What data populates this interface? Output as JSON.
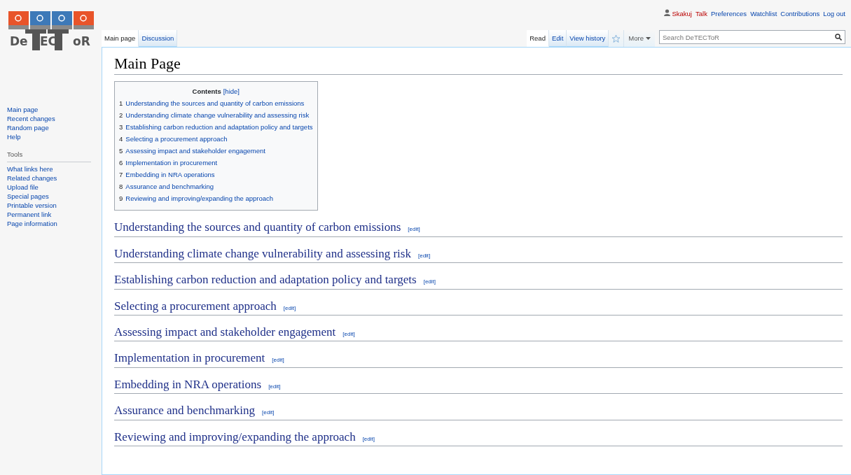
{
  "personal": [
    {
      "label": "Skakuj",
      "redlink": true,
      "kind": "user"
    },
    {
      "label": "Talk",
      "redlink": true,
      "kind": "link"
    },
    {
      "label": "Preferences",
      "redlink": false,
      "kind": "link"
    },
    {
      "label": "Watchlist",
      "redlink": false,
      "kind": "link"
    },
    {
      "label": "Contributions",
      "redlink": false,
      "kind": "link"
    },
    {
      "label": "Log out",
      "redlink": false,
      "kind": "link"
    }
  ],
  "logo": {
    "parts": [
      "De",
      "EC",
      "oR"
    ]
  },
  "left_tabs": [
    {
      "label": "Main page",
      "selected": true
    },
    {
      "label": "Discussion",
      "selected": false
    }
  ],
  "right_tabs": [
    {
      "label": "Read",
      "selected": true,
      "kind": "tab"
    },
    {
      "label": "Edit",
      "selected": false,
      "kind": "tab"
    },
    {
      "label": "View history",
      "selected": false,
      "kind": "tab"
    },
    {
      "kind": "watch"
    },
    {
      "label": "More",
      "kind": "menu"
    }
  ],
  "search": {
    "placeholder": "Search DeTECToR"
  },
  "sidebar": {
    "items": [
      "Main page",
      "Recent changes",
      "Random page",
      "Help"
    ],
    "tools_heading": "Tools",
    "tools": [
      "What links here",
      "Related changes",
      "Upload file",
      "Special pages",
      "Printable version",
      "Permanent link",
      "Page information"
    ]
  },
  "title": "Main Page",
  "toc": {
    "title": "Contents",
    "toggle": "[hide]",
    "entries": [
      {
        "number": "1",
        "text": "Understanding the sources and quantity of carbon emissions"
      },
      {
        "number": "2",
        "text": "Understanding climate change vulnerability and assessing risk"
      },
      {
        "number": "3",
        "text": "Establishing carbon reduction and adaptation policy and targets"
      },
      {
        "number": "4",
        "text": "Selecting a procurement approach"
      },
      {
        "number": "5",
        "text": "Assessing impact and stakeholder engagement"
      },
      {
        "number": "6",
        "text": "Implementation in procurement"
      },
      {
        "number": "7",
        "text": "Embedding in NRA operations"
      },
      {
        "number": "8",
        "text": "Assurance and benchmarking"
      },
      {
        "number": "9",
        "text": "Reviewing and improving/expanding the approach"
      }
    ]
  },
  "sections": [
    {
      "heading": "Understanding the sources and quantity of carbon emissions",
      "edit": "[edit]"
    },
    {
      "heading": "Understanding climate change vulnerability and assessing risk",
      "edit": "[edit]"
    },
    {
      "heading": "Establishing carbon reduction and adaptation policy and targets",
      "edit": "[edit]"
    },
    {
      "heading": "Selecting a procurement approach",
      "edit": "[edit]"
    },
    {
      "heading": "Assessing impact and stakeholder engagement",
      "edit": "[edit]"
    },
    {
      "heading": "Implementation in procurement",
      "edit": "[edit]"
    },
    {
      "heading": "Embedding in NRA operations",
      "edit": "[edit]"
    },
    {
      "heading": "Assurance and benchmarking",
      "edit": "[edit]"
    },
    {
      "heading": "Reviewing and improving/expanding the approach",
      "edit": "[edit]"
    }
  ]
}
